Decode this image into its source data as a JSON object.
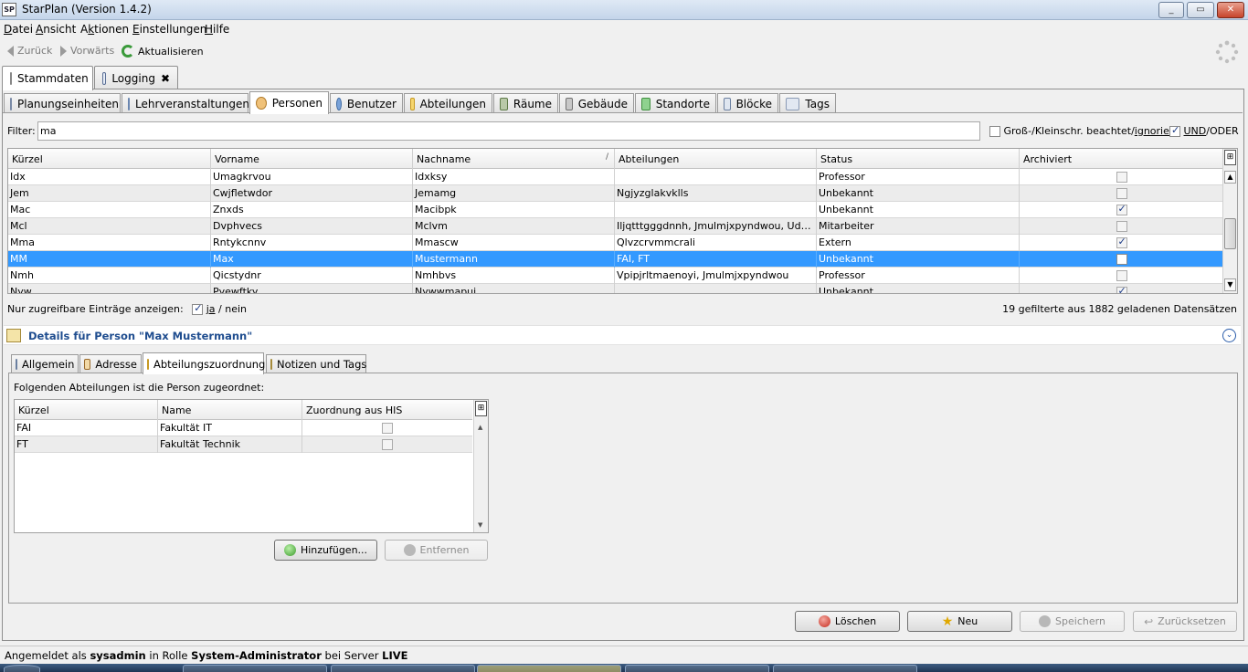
{
  "window": {
    "icon_text": "SP",
    "title": "StarPlan (Version 1.4.2)",
    "controls": {
      "minimize": "_",
      "maximize": "▭",
      "close": "✕"
    }
  },
  "menu": {
    "items": [
      {
        "pre": "",
        "ul": "D",
        "post": "atei"
      },
      {
        "pre": "",
        "ul": "A",
        "post": "nsicht"
      },
      {
        "pre": "A",
        "ul": "k",
        "post": "tionen"
      },
      {
        "pre": "",
        "ul": "E",
        "post": "instellungen"
      },
      {
        "pre": "",
        "ul": "H",
        "post": "ilfe"
      }
    ]
  },
  "toolbar": {
    "back": "Zurück",
    "forward": "Vorwärts",
    "refresh": "Aktualisieren"
  },
  "main_tabs": [
    {
      "label": "Stammdaten",
      "active": true
    },
    {
      "label": "Logging",
      "active": false,
      "close": "✖"
    }
  ],
  "sub_tabs": [
    {
      "label": "Planungseinheiten"
    },
    {
      "label": "Lehrveranstaltungen"
    },
    {
      "label": "Personen",
      "active": true
    },
    {
      "label": "Benutzer"
    },
    {
      "label": "Abteilungen"
    },
    {
      "label": "Räume"
    },
    {
      "label": "Gebäude"
    },
    {
      "label": "Standorte"
    },
    {
      "label": "Blöcke"
    },
    {
      "label": "Tags"
    }
  ],
  "filter": {
    "label": "Filter:",
    "value": "ma",
    "case_label_prefix": "Groß-/Kleinschr. beachtet/",
    "case_label_link": "ignoriert",
    "case_checked": false,
    "andor_label_prefix": "UND",
    "andor_label_suffix": "/ODER",
    "andor_checked": true
  },
  "persons_table": {
    "columns": [
      "Kürzel",
      "Vorname",
      "Nachname",
      "Abteilungen",
      "Status",
      "Archiviert"
    ],
    "sort_indicator": "/",
    "column_selector": "⊞",
    "rows": [
      {
        "kuerzel": "Idx",
        "vorname": "Umagkrvou",
        "nachname": "Idxksy",
        "abteilungen": "",
        "status": "Professor",
        "archiviert": false
      },
      {
        "kuerzel": "Jem",
        "vorname": "Cwjfletwdor",
        "nachname": "Jemamg",
        "abteilungen": "Ngjyzglakvklls",
        "status": "Unbekannt",
        "archiviert": false
      },
      {
        "kuerzel": "Mac",
        "vorname": "Znxds",
        "nachname": "Macibpk",
        "abteilungen": "",
        "status": "Unbekannt",
        "archiviert": true
      },
      {
        "kuerzel": "Mcl",
        "vorname": "Dvphvecs",
        "nachname": "Mclvm",
        "abteilungen": "Iljqtttgggdnnh, Jmulmjxpyndwou, Uddzry…",
        "status": "Mitarbeiter",
        "archiviert": false
      },
      {
        "kuerzel": "Mma",
        "vorname": "Rntykcnnv",
        "nachname": "Mmascw",
        "abteilungen": "Qlvzcrvmmcrali",
        "status": "Extern",
        "archiviert": true
      },
      {
        "kuerzel": "MM",
        "vorname": "Max",
        "nachname": "Mustermann",
        "abteilungen": "FAI, FT",
        "status": "Unbekannt",
        "archiviert": false,
        "selected": true
      },
      {
        "kuerzel": "Nmh",
        "vorname": "Qicstydnr",
        "nachname": "Nmhbvs",
        "abteilungen": "Vpipjrltmaenoyi, Jmulmjxpyndwou",
        "status": "Professor",
        "archiviert": false
      },
      {
        "kuerzel": "Nyw",
        "vorname": "Pyewftky",
        "nachname": "Nywwmapui",
        "abteilungen": "",
        "status": "Unbekannt",
        "archiviert": true
      }
    ]
  },
  "accessible": {
    "label": "Nur zugreifbare Einträge anzeigen:",
    "yes": "ja",
    "sep": " / ",
    "no": "nein",
    "checked": true
  },
  "record_count": "19 gefilterte aus 1882 geladenen Datensätzen",
  "details": {
    "title": "Details für Person \"Max Mustermann\"",
    "collapse": "⌄",
    "tabs": [
      {
        "label": "Allgemein"
      },
      {
        "label": "Adresse"
      },
      {
        "label": "Abteilungszuordnung",
        "active": true
      },
      {
        "label": "Notizen und Tags"
      }
    ],
    "assign_label": "Folgenden Abteilungen ist die Person zugeordnet:",
    "dept_table": {
      "columns": [
        "Kürzel",
        "Name",
        "Zuordnung aus HIS"
      ],
      "rows": [
        {
          "kuerzel": "FAI",
          "name": "Fakultät IT",
          "his": false
        },
        {
          "kuerzel": "FT",
          "name": "Fakultät Technik",
          "his": false
        }
      ]
    },
    "add_button": "Hinzufügen...",
    "remove_button": "Entfernen"
  },
  "actions": {
    "delete": "Löschen",
    "new": "Neu",
    "save": "Speichern",
    "reset": "Zurücksetzen"
  },
  "statusbar": {
    "prefix": "Angemeldet als ",
    "user": "sysadmin",
    "mid": " in Rolle ",
    "role": "System-Administrator",
    "mid2": " bei Server ",
    "server": "LIVE"
  },
  "colors": {
    "selection": "#3399ff",
    "details_title": "#1f4d8f",
    "check": "#1b3a86"
  }
}
